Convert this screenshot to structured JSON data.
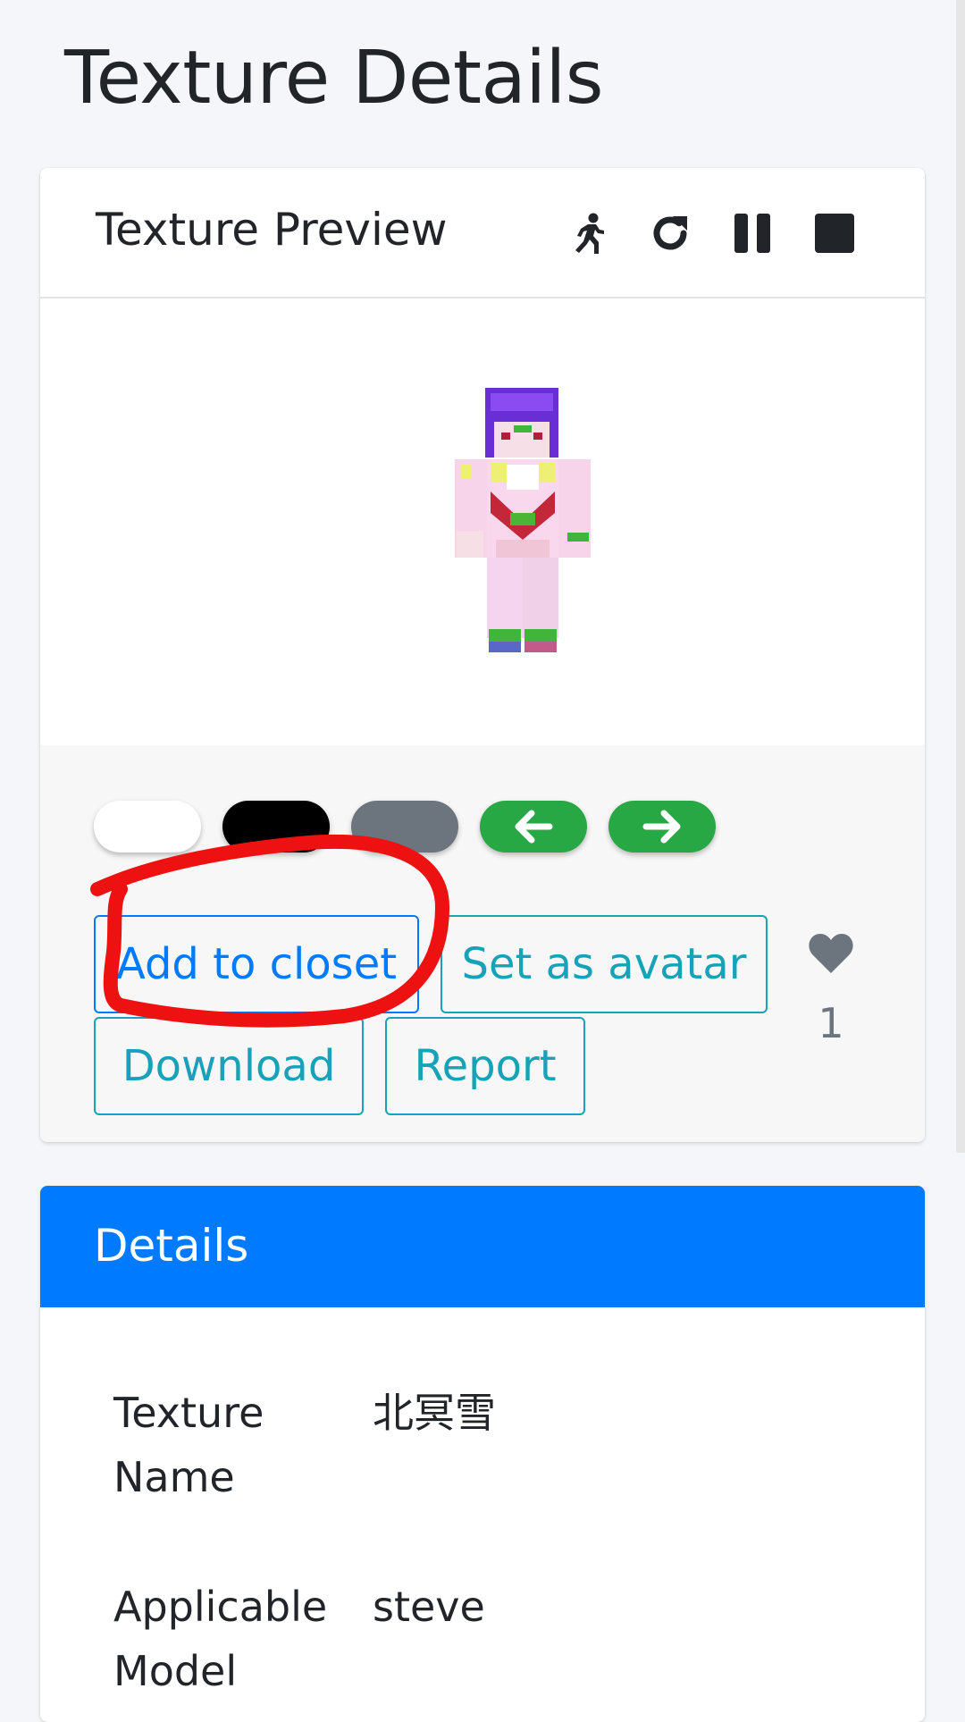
{
  "page": {
    "title": "Texture Details"
  },
  "preview": {
    "title": "Texture Preview",
    "tools": [
      "running-icon",
      "rotate-icon",
      "pause-icon",
      "stop-icon"
    ]
  },
  "backgrounds": {
    "colors": [
      "#ffffff",
      "#000000",
      "#6c757d"
    ],
    "nav_color": "#28a745"
  },
  "actions": {
    "add_to_closet": "Add to closet",
    "set_as_avatar": "Set as avatar",
    "download": "Download",
    "report": "Report"
  },
  "likes": {
    "count": "1"
  },
  "details": {
    "title": "Details",
    "rows": [
      {
        "label": "Texture Name",
        "value": "北冥雪"
      },
      {
        "label": "Applicable Model",
        "value": "steve"
      }
    ]
  },
  "colors": {
    "primary": "#007bff",
    "info": "#17a2b8",
    "annotation": "#ee1111"
  }
}
